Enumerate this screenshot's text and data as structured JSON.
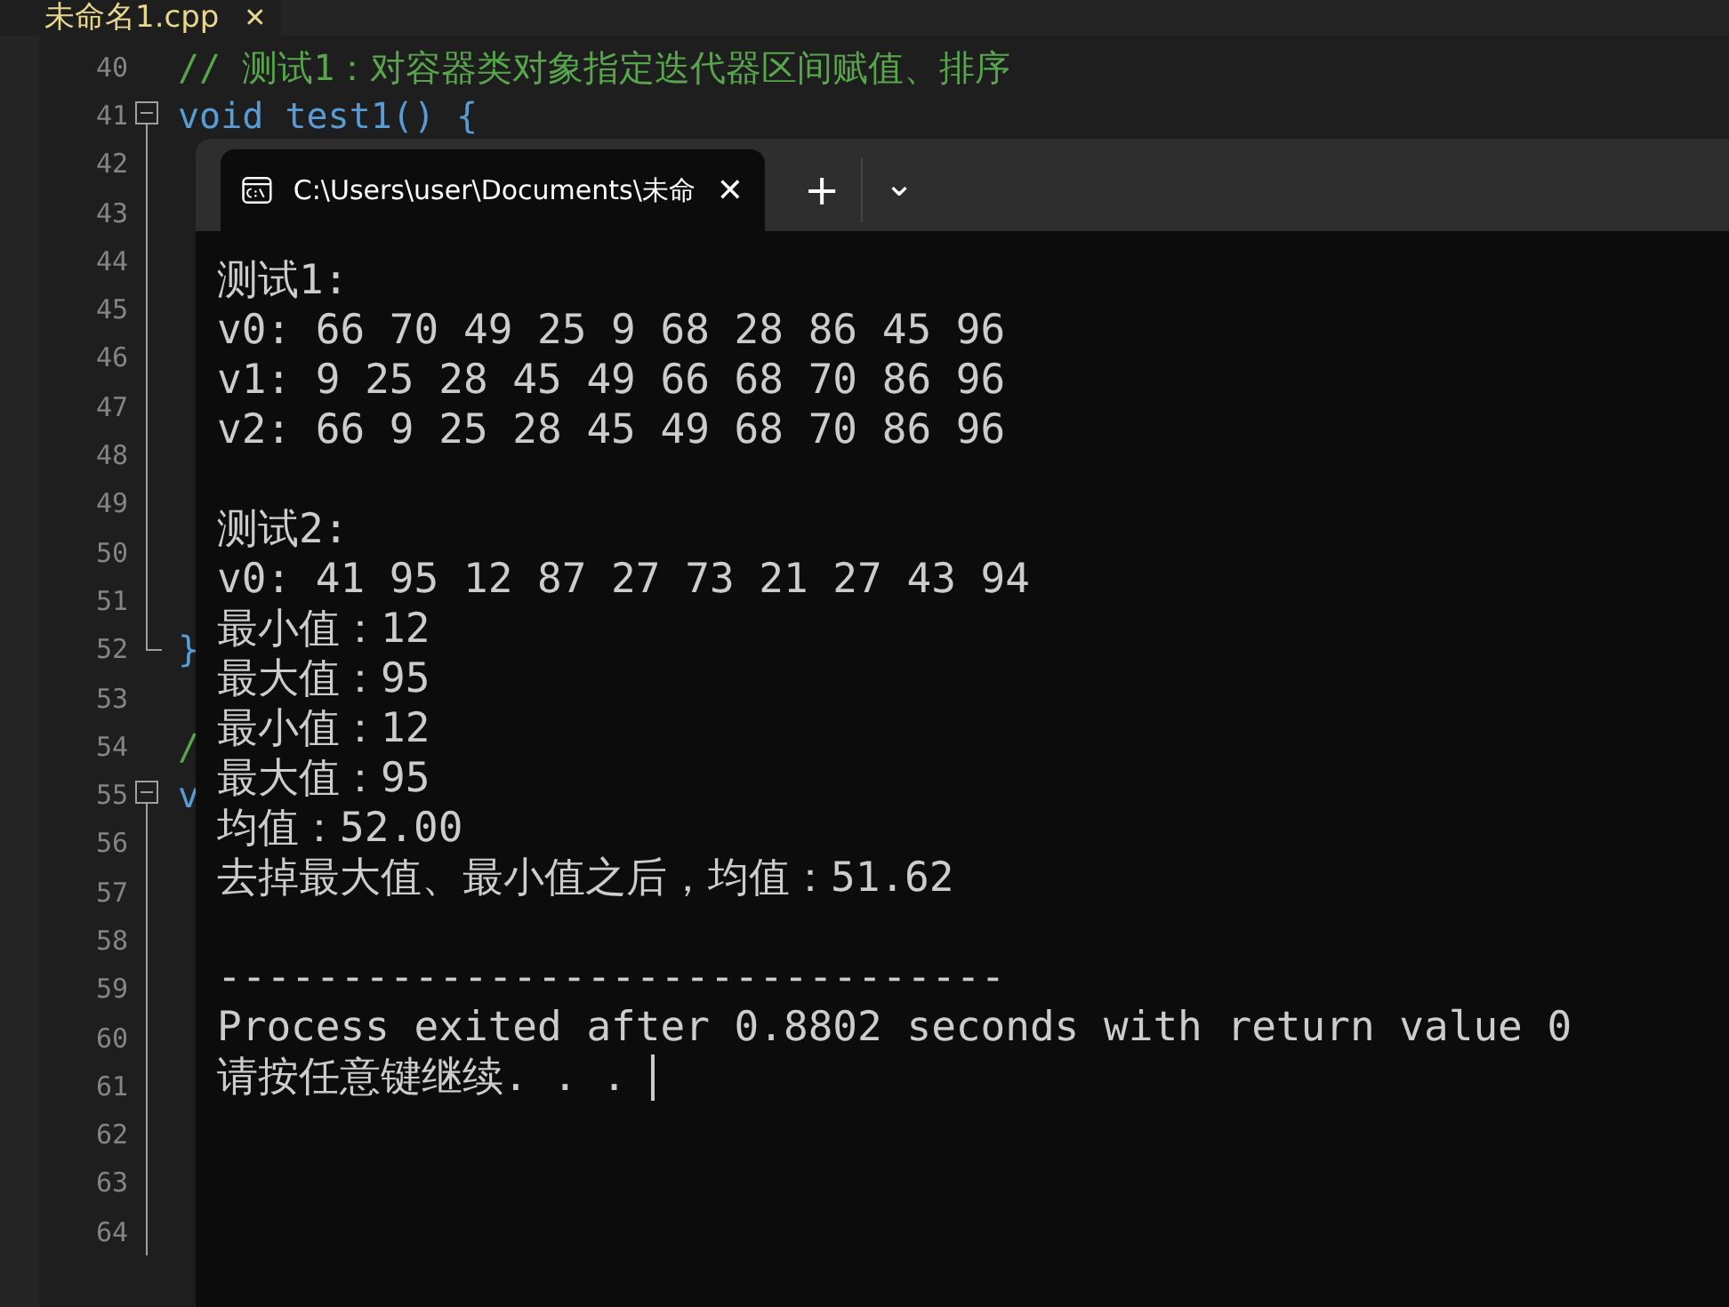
{
  "editor_tab": {
    "label": "未命名1.cpp",
    "close": "✕"
  },
  "code_lines": [
    {
      "number": "40",
      "text": "// 测试1：对容器类对象指定迭代器区间赋值、排序",
      "kind": "comment",
      "collapsible": false,
      "fold_end": false
    },
    {
      "number": "41",
      "text": "void test1() {",
      "kind": "code",
      "collapsible": true,
      "fold_end": false
    },
    {
      "number": "42",
      "collapsible": false,
      "fold_end": false
    },
    {
      "number": "43",
      "collapsible": false,
      "fold_end": false
    },
    {
      "number": "44",
      "collapsible": false,
      "fold_end": false
    },
    {
      "number": "45",
      "collapsible": false,
      "fold_end": false
    },
    {
      "number": "46",
      "collapsible": false,
      "fold_end": false
    },
    {
      "number": "47",
      "collapsible": false,
      "fold_end": false
    },
    {
      "number": "48",
      "collapsible": false,
      "fold_end": false
    },
    {
      "number": "49",
      "collapsible": false,
      "fold_end": false
    },
    {
      "number": "50",
      "collapsible": false,
      "fold_end": false
    },
    {
      "number": "51",
      "collapsible": false,
      "fold_end": false
    },
    {
      "number": "52",
      "text": "}",
      "kind": "code",
      "collapsible": false,
      "fold_end": true
    },
    {
      "number": "53",
      "collapsible": false,
      "fold_end": false
    },
    {
      "number": "54",
      "text": "/",
      "kind": "comment",
      "collapsible": false,
      "fold_end": false
    },
    {
      "number": "55",
      "text": "v",
      "kind": "code",
      "collapsible": true,
      "fold_end": false
    },
    {
      "number": "56",
      "collapsible": false,
      "fold_end": false
    },
    {
      "number": "57",
      "collapsible": false,
      "fold_end": false
    },
    {
      "number": "58",
      "collapsible": false,
      "fold_end": false
    },
    {
      "number": "59",
      "collapsible": false,
      "fold_end": false
    },
    {
      "number": "60",
      "collapsible": false,
      "fold_end": false
    },
    {
      "number": "61",
      "collapsible": false,
      "fold_end": false
    },
    {
      "number": "62",
      "collapsible": false,
      "fold_end": false
    },
    {
      "number": "63",
      "collapsible": false,
      "fold_end": false
    },
    {
      "number": "64",
      "collapsible": false,
      "fold_end": false
    }
  ],
  "terminal": {
    "tab_title": "C:\\Users\\user\\Documents\\未命",
    "close": "✕",
    "new_tab": "+",
    "dropdown": "⌄",
    "output_blocks": [
      [
        "测试1:",
        "v0: 66 70 49 25 9 68 28 86 45 96",
        "v1: 9 25 28 45 49 66 68 70 86 96",
        "v2: 66 9 25 28 45 49 68 70 86 96"
      ],
      [
        "测试2:",
        "v0: 41 95 12 87 27 73 21 27 43 94",
        "最小值：12",
        "最大值：95",
        "最小值：12",
        "最大值：95",
        "均值：52.00",
        "去掉最大值、最小值之后，均值：51.62"
      ],
      [
        "--------------------------------",
        "Process exited after 0.8802 seconds with return value 0",
        "请按任意键继续. . ."
      ]
    ],
    "cursor": true
  }
}
